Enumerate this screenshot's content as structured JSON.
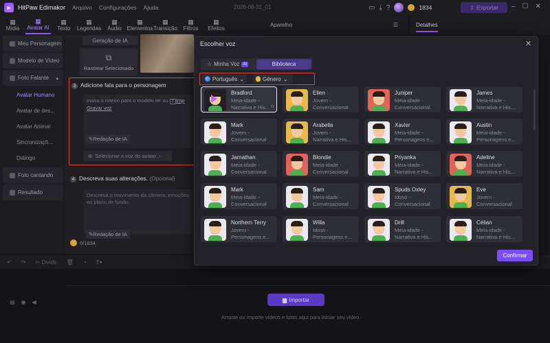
{
  "titlebar": {
    "app_name": "HitPaw Edimakor",
    "menus": [
      "Arquivo",
      "Configurações",
      "Ajuda"
    ],
    "datestamp": "2026-08-31_01",
    "credits": "1834",
    "export_label": "Exportar"
  },
  "toolbar": {
    "items": [
      {
        "label": "Mídia",
        "icon": "media-icon"
      },
      {
        "label": "Avatar AI",
        "icon": "avatar-icon"
      },
      {
        "label": "Texto",
        "icon": "text-icon"
      },
      {
        "label": "Legendas",
        "icon": "subtitles-icon"
      },
      {
        "label": "Áudio",
        "icon": "audio-icon"
      },
      {
        "label": "Elementos",
        "icon": "elements-icon"
      },
      {
        "label": "Transição",
        "icon": "transition-icon"
      },
      {
        "label": "Filtros",
        "icon": "filters-icon"
      },
      {
        "label": "Efeitos",
        "icon": "effects-icon"
      }
    ]
  },
  "sidebar": {
    "items": [
      {
        "label": "Meu Personagem",
        "kind": "group"
      },
      {
        "label": "Modelo de Vídeo",
        "kind": "group"
      },
      {
        "label": "Foto Falante",
        "kind": "group"
      },
      {
        "label": "Avatar Humano",
        "kind": "sub",
        "selected": true
      },
      {
        "label": "Avatar de des...",
        "kind": "sub"
      },
      {
        "label": "Avatar Animal",
        "kind": "sub"
      },
      {
        "label": "Sincronizaçõ...",
        "kind": "sub"
      },
      {
        "label": "Diálogo",
        "kind": "sub"
      },
      {
        "label": "Foto cantando",
        "kind": "group"
      },
      {
        "label": "Resultado",
        "kind": "group"
      }
    ]
  },
  "middle": {
    "generation_label": "Geração de IA",
    "trace_selected": "Rastrear Selecionado",
    "step3_number": "3",
    "step3_title": "Adicione fala para o personagem",
    "script_placeholder": "Insira o roteiro para o modelo ler ou",
    "import_link": "Imp",
    "record_voice": "Gravar voz",
    "ai_writing": "Redação de IA",
    "select_voice": "Selecionar a voz do avatar",
    "step4_number": "4",
    "step4_title": "Descreva suas alterações.",
    "step4_optional": "(Opcional)",
    "changes_placeholder": "Descreva o movimento da câmera, emoções ou plano de fundo.",
    "ai_writing_2": "Redação de IA",
    "credit_counter": "0/1834"
  },
  "preview": {
    "header": "Aparelho"
  },
  "details": {
    "header": "Detalhes"
  },
  "timeline": {
    "split_label": "Dividir",
    "import_label": "Importar",
    "drop_hint": "Arraste ou importe vídeos e fotos aqui para iniciar seu vídeo."
  },
  "modal": {
    "title": "Escolher voz",
    "tab_my_voice": "Minha Voz",
    "ai_badge": "AI",
    "tab_library": "Biblioteca",
    "filter_language": "Português",
    "filter_gender": "Gênero",
    "confirm_label": "Confirmar",
    "voices": [
      {
        "name": "Bradford",
        "l1": "Meia-idade -",
        "l2": "Narrativa e His...",
        "face": "#1f1f24",
        "selected": true
      },
      {
        "name": "Ellen",
        "l1": "Jovem -",
        "l2": "Conversacional",
        "face": "#e8b84a"
      },
      {
        "name": "Juniper",
        "l1": "Meia-idade -",
        "l2": "Conversacional",
        "face": "#e0645a"
      },
      {
        "name": "James",
        "l1": "Meia-idade -",
        "l2": "Narrativa e His...",
        "face": "#e9e9ee"
      },
      {
        "name": "Mark",
        "l1": "Jovem -",
        "l2": "Conversacional",
        "face": "#e9e9ee"
      },
      {
        "name": "Arabella",
        "l1": "Jovem -",
        "l2": "Narrativa e His...",
        "face": "#e8b84a"
      },
      {
        "name": "Xavier",
        "l1": "Meia-idade -",
        "l2": "Personagens e...",
        "face": "#e9e9ee"
      },
      {
        "name": "Austin",
        "l1": "Meia-idade -",
        "l2": "Personagens e...",
        "face": "#e9e9ee"
      },
      {
        "name": "Jarnathan",
        "l1": "Meia-idade -",
        "l2": "Conversacional",
        "face": "#e9e9ee"
      },
      {
        "name": "Blondie",
        "l1": "Meia-idade -",
        "l2": "Conversacional",
        "face": "#e0645a"
      },
      {
        "name": "Priyanka",
        "l1": "Meia-idade -",
        "l2": "Narrativa e His...",
        "face": "#e9e9ee"
      },
      {
        "name": "Adeline",
        "l1": "Meia-idade -",
        "l2": "Narrativa e His...",
        "face": "#e0645a"
      },
      {
        "name": "Mark",
        "l1": "Meia-idade -",
        "l2": "Conversacional",
        "face": "#e9e9ee"
      },
      {
        "name": "Sam",
        "l1": "Meia-idade -",
        "l2": "Conversacional",
        "face": "#e9e9ee"
      },
      {
        "name": "Spuds Oxley",
        "l1": "Idoso -",
        "l2": "Conversacional",
        "face": "#e9e9ee"
      },
      {
        "name": "Eve",
        "l1": "Jovem -",
        "l2": "Conversacional",
        "face": "#e8b84a"
      },
      {
        "name": "Northern Terry",
        "l1": "Jovem -",
        "l2": "Personagens e...",
        "face": "#e9e9ee"
      },
      {
        "name": "Willa",
        "l1": "Idoso -",
        "l2": "Personagens e...",
        "face": "#e9e9ee"
      },
      {
        "name": "Drill",
        "l1": "Meia-idade -",
        "l2": "Narrativa e His...",
        "face": "#e9e9ee"
      },
      {
        "name": "Célian",
        "l1": "Meia-idade -",
        "l2": "Narrativa e His...",
        "face": "#e9e9ee"
      }
    ]
  },
  "colors": {
    "accent": "#7c4dff",
    "highlight_red": "#e0493a"
  }
}
